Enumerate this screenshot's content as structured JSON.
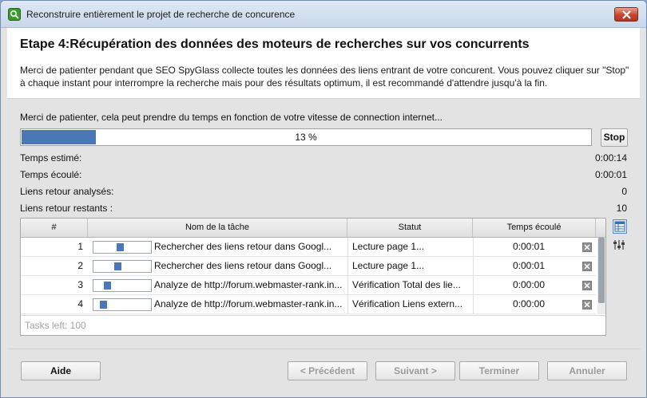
{
  "window": {
    "title": "Reconstruire entièrement le projet de recherche de concurence",
    "close_icon": "close-icon"
  },
  "header": {
    "title": "Etape 4:Récupération des données des moteurs de recherches sur vos concurrents",
    "description": "Merci de patienter pendant que SEO SpyGlass collecte toutes les données des liens entrant de votre concurent. Vous pouvez cliquer sur \"Stop\" à chaque instant pour interrompre la recherche mais pour des résultats optimum, il est recommandé d'attendre jusqu'à la fin."
  },
  "progress": {
    "message": "Merci de patienter, cela peut prendre du temps en fonction de votre vitesse de connection internet...",
    "percent": 13,
    "percent_label": "13 %",
    "stop_label": "Stop"
  },
  "stats": [
    {
      "label": "Temps estimé:",
      "value": "0:00:14"
    },
    {
      "label": "Temps écoulé:",
      "value": "0:00:01"
    },
    {
      "label": "Liens retour analysés:",
      "value": "0"
    },
    {
      "label": "Liens retour restants :",
      "value": "10"
    }
  ],
  "table": {
    "columns": [
      "#",
      "Nom de la tâche",
      "Statut",
      "Temps écoulé"
    ],
    "rows": [
      {
        "num": "1",
        "progress": 0.45,
        "task": "Rechercher des liens retour  dans Googl...",
        "status": "Lecture page 1...",
        "time": "0:00:01"
      },
      {
        "num": "2",
        "progress": 0.4,
        "task": "Rechercher des liens retour  dans Googl...",
        "status": "Lecture page 1...",
        "time": "0:00:01"
      },
      {
        "num": "3",
        "progress": 0.18,
        "task": "Analyze de http://forum.webmaster-rank.in...",
        "status": "Vérification Total des lie...",
        "time": "0:00:00"
      },
      {
        "num": "4",
        "progress": 0.1,
        "task": "Analyze de http://forum.webmaster-rank.in...",
        "status": "Vérification Liens extern...",
        "time": "0:00:00"
      }
    ],
    "tasks_left": "Tasks left: 100"
  },
  "side_icons": [
    "table-view-icon",
    "column-settings-icon"
  ],
  "buttons": {
    "help": "Aide",
    "previous": "< Précédent",
    "next": "Suivant >",
    "finish": "Terminer",
    "cancel": "Annuler"
  },
  "colors": {
    "accent": "#4a78b6",
    "window_bg": "#e3e3e3"
  }
}
